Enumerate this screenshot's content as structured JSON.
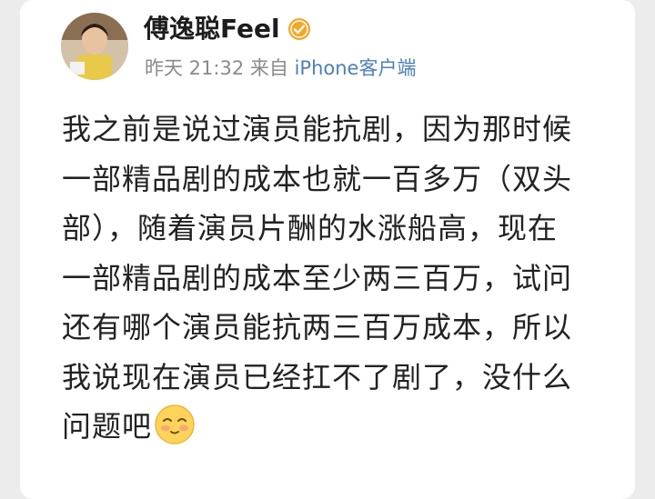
{
  "post": {
    "author": "傅逸聪Feel",
    "badge_icon": "verified-badge-icon",
    "time": "昨天 21:32",
    "source_prefix": "来自",
    "source_client": "iPhone客户端",
    "lines": [
      "我之前是说过演员能抗剧，因为那时候",
      "一部精品剧的成本也就一百多万（双头",
      "部），随着演员片酬的水涨船高，现在",
      "一部精品剧的成本至少两三百万，试问",
      "还有哪个演员能抗两三百万成本，所以",
      "我说现在演员已经扛不了剧了，没什么",
      "问题吧"
    ],
    "emoji_icon": "blush-face-emoji-icon"
  },
  "colors": {
    "page_background": "#ececec",
    "card_background": "#ffffff",
    "text": "#222222",
    "meta_text": "#8a8a8a",
    "client_link": "#4e7fb8",
    "badge": "#f5a623"
  }
}
